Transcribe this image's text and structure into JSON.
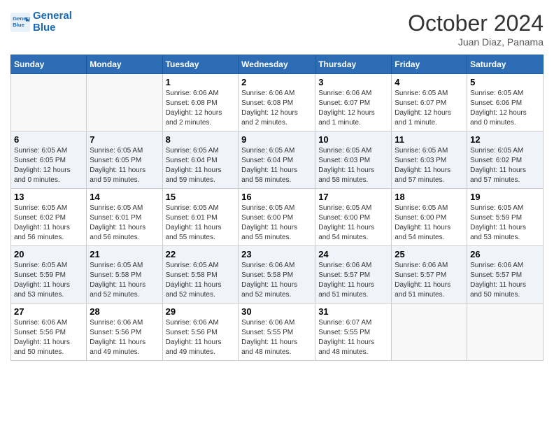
{
  "logo": {
    "line1": "General",
    "line2": "Blue"
  },
  "title": "October 2024",
  "subtitle": "Juan Diaz, Panama",
  "days_header": [
    "Sunday",
    "Monday",
    "Tuesday",
    "Wednesday",
    "Thursday",
    "Friday",
    "Saturday"
  ],
  "weeks": [
    [
      {
        "day": "",
        "info": ""
      },
      {
        "day": "",
        "info": ""
      },
      {
        "day": "1",
        "info": "Sunrise: 6:06 AM\nSunset: 6:08 PM\nDaylight: 12 hours\nand 2 minutes."
      },
      {
        "day": "2",
        "info": "Sunrise: 6:06 AM\nSunset: 6:08 PM\nDaylight: 12 hours\nand 2 minutes."
      },
      {
        "day": "3",
        "info": "Sunrise: 6:06 AM\nSunset: 6:07 PM\nDaylight: 12 hours\nand 1 minute."
      },
      {
        "day": "4",
        "info": "Sunrise: 6:05 AM\nSunset: 6:07 PM\nDaylight: 12 hours\nand 1 minute."
      },
      {
        "day": "5",
        "info": "Sunrise: 6:05 AM\nSunset: 6:06 PM\nDaylight: 12 hours\nand 0 minutes."
      }
    ],
    [
      {
        "day": "6",
        "info": "Sunrise: 6:05 AM\nSunset: 6:05 PM\nDaylight: 12 hours\nand 0 minutes."
      },
      {
        "day": "7",
        "info": "Sunrise: 6:05 AM\nSunset: 6:05 PM\nDaylight: 11 hours\nand 59 minutes."
      },
      {
        "day": "8",
        "info": "Sunrise: 6:05 AM\nSunset: 6:04 PM\nDaylight: 11 hours\nand 59 minutes."
      },
      {
        "day": "9",
        "info": "Sunrise: 6:05 AM\nSunset: 6:04 PM\nDaylight: 11 hours\nand 58 minutes."
      },
      {
        "day": "10",
        "info": "Sunrise: 6:05 AM\nSunset: 6:03 PM\nDaylight: 11 hours\nand 58 minutes."
      },
      {
        "day": "11",
        "info": "Sunrise: 6:05 AM\nSunset: 6:03 PM\nDaylight: 11 hours\nand 57 minutes."
      },
      {
        "day": "12",
        "info": "Sunrise: 6:05 AM\nSunset: 6:02 PM\nDaylight: 11 hours\nand 57 minutes."
      }
    ],
    [
      {
        "day": "13",
        "info": "Sunrise: 6:05 AM\nSunset: 6:02 PM\nDaylight: 11 hours\nand 56 minutes."
      },
      {
        "day": "14",
        "info": "Sunrise: 6:05 AM\nSunset: 6:01 PM\nDaylight: 11 hours\nand 56 minutes."
      },
      {
        "day": "15",
        "info": "Sunrise: 6:05 AM\nSunset: 6:01 PM\nDaylight: 11 hours\nand 55 minutes."
      },
      {
        "day": "16",
        "info": "Sunrise: 6:05 AM\nSunset: 6:00 PM\nDaylight: 11 hours\nand 55 minutes."
      },
      {
        "day": "17",
        "info": "Sunrise: 6:05 AM\nSunset: 6:00 PM\nDaylight: 11 hours\nand 54 minutes."
      },
      {
        "day": "18",
        "info": "Sunrise: 6:05 AM\nSunset: 6:00 PM\nDaylight: 11 hours\nand 54 minutes."
      },
      {
        "day": "19",
        "info": "Sunrise: 6:05 AM\nSunset: 5:59 PM\nDaylight: 11 hours\nand 53 minutes."
      }
    ],
    [
      {
        "day": "20",
        "info": "Sunrise: 6:05 AM\nSunset: 5:59 PM\nDaylight: 11 hours\nand 53 minutes."
      },
      {
        "day": "21",
        "info": "Sunrise: 6:05 AM\nSunset: 5:58 PM\nDaylight: 11 hours\nand 52 minutes."
      },
      {
        "day": "22",
        "info": "Sunrise: 6:05 AM\nSunset: 5:58 PM\nDaylight: 11 hours\nand 52 minutes."
      },
      {
        "day": "23",
        "info": "Sunrise: 6:06 AM\nSunset: 5:58 PM\nDaylight: 11 hours\nand 52 minutes."
      },
      {
        "day": "24",
        "info": "Sunrise: 6:06 AM\nSunset: 5:57 PM\nDaylight: 11 hours\nand 51 minutes."
      },
      {
        "day": "25",
        "info": "Sunrise: 6:06 AM\nSunset: 5:57 PM\nDaylight: 11 hours\nand 51 minutes."
      },
      {
        "day": "26",
        "info": "Sunrise: 6:06 AM\nSunset: 5:57 PM\nDaylight: 11 hours\nand 50 minutes."
      }
    ],
    [
      {
        "day": "27",
        "info": "Sunrise: 6:06 AM\nSunset: 5:56 PM\nDaylight: 11 hours\nand 50 minutes."
      },
      {
        "day": "28",
        "info": "Sunrise: 6:06 AM\nSunset: 5:56 PM\nDaylight: 11 hours\nand 49 minutes."
      },
      {
        "day": "29",
        "info": "Sunrise: 6:06 AM\nSunset: 5:56 PM\nDaylight: 11 hours\nand 49 minutes."
      },
      {
        "day": "30",
        "info": "Sunrise: 6:06 AM\nSunset: 5:55 PM\nDaylight: 11 hours\nand 48 minutes."
      },
      {
        "day": "31",
        "info": "Sunrise: 6:07 AM\nSunset: 5:55 PM\nDaylight: 11 hours\nand 48 minutes."
      },
      {
        "day": "",
        "info": ""
      },
      {
        "day": "",
        "info": ""
      }
    ]
  ]
}
